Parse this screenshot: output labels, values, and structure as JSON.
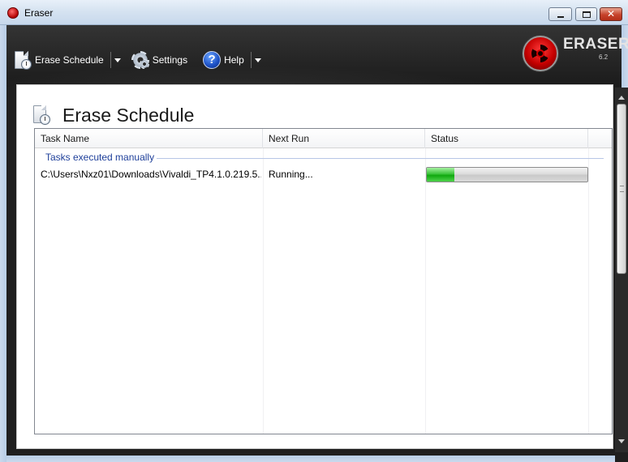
{
  "window": {
    "title": "Eraser"
  },
  "toolbar": {
    "erase_schedule_label": "Erase Schedule",
    "settings_label": "Settings",
    "help_label": "Help"
  },
  "logo": {
    "name": "ERASER",
    "version": "6.2"
  },
  "page": {
    "title": "Erase Schedule"
  },
  "table": {
    "columns": [
      "Task Name",
      "Next Run",
      "Status",
      ""
    ],
    "group_label": "Tasks executed manually",
    "rows": [
      {
        "task_name": "C:\\Users\\Nxz01\\Downloads\\Vivaldi_TP4.1.0.219.5...",
        "next_run": "Running...",
        "progress": 0.17
      }
    ]
  },
  "colors": {
    "progress_fill": "#10a80f",
    "group_text": "#1e3f9a",
    "chrome_bg": "#262626"
  }
}
